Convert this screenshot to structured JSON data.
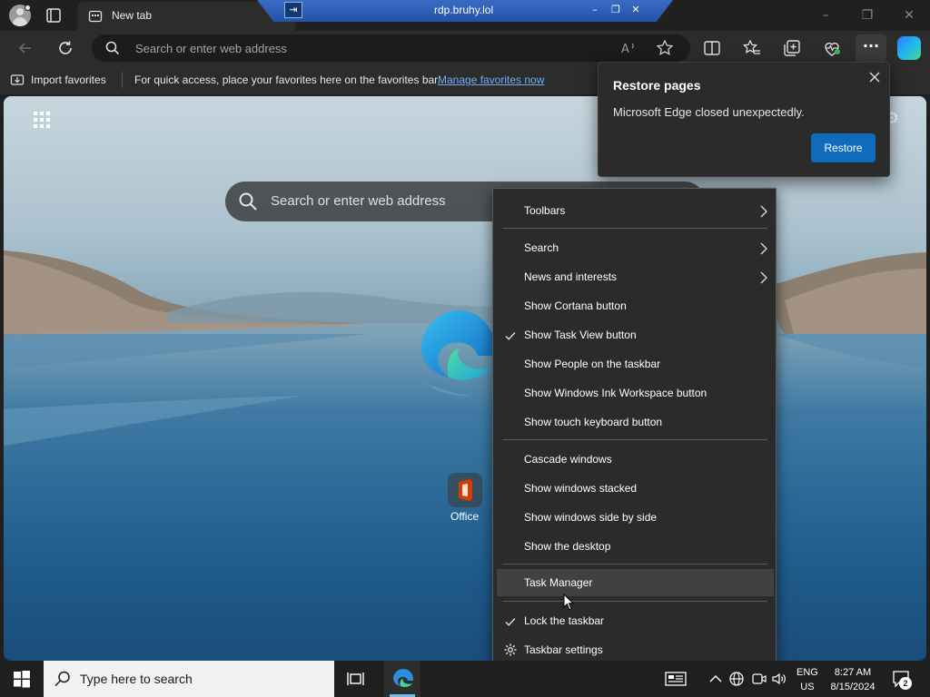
{
  "browser": {
    "tab_title": "New tab",
    "rdp_title": "rdp.bruhy.lol",
    "address_placeholder": "Search or enter web address"
  },
  "favorites_bar": {
    "import_label": "Import favorites",
    "hint": "For quick access, place your favorites here on the favorites bar.",
    "manage_link": "Manage favorites now"
  },
  "new_tab": {
    "search_placeholder": "Search or enter web address",
    "tiles": [
      {
        "label": "Office"
      }
    ]
  },
  "restore_popup": {
    "title": "Restore pages",
    "message": "Microsoft Edge closed unexpectedly.",
    "button": "Restore"
  },
  "context_menu": {
    "items": [
      {
        "label": "Toolbars",
        "submenu": true
      },
      {
        "label": "Search",
        "submenu": true
      },
      {
        "label": "News and interests",
        "submenu": true
      },
      {
        "label": "Show Cortana button"
      },
      {
        "label": "Show Task View button",
        "checked": true
      },
      {
        "label": "Show People on the taskbar"
      },
      {
        "label": "Show Windows Ink Workspace button"
      },
      {
        "label": "Show touch keyboard button"
      },
      {
        "label": "Cascade windows"
      },
      {
        "label": "Show windows stacked"
      },
      {
        "label": "Show windows side by side"
      },
      {
        "label": "Show the desktop"
      },
      {
        "label": "Task Manager",
        "highlighted": true
      },
      {
        "label": "Lock the taskbar",
        "checked": true
      },
      {
        "label": "Taskbar settings",
        "icon": "gear-icon"
      }
    ]
  },
  "taskbar": {
    "search_placeholder": "Type here to search",
    "lang_line1": "ENG",
    "lang_line2": "US",
    "time": "8:27 AM",
    "date": "8/15/2024",
    "notification_count": "2"
  },
  "colors": {
    "accent": "#0f6cbd",
    "menu_bg": "#2b2b2b",
    "link": "#6fb0f5"
  }
}
